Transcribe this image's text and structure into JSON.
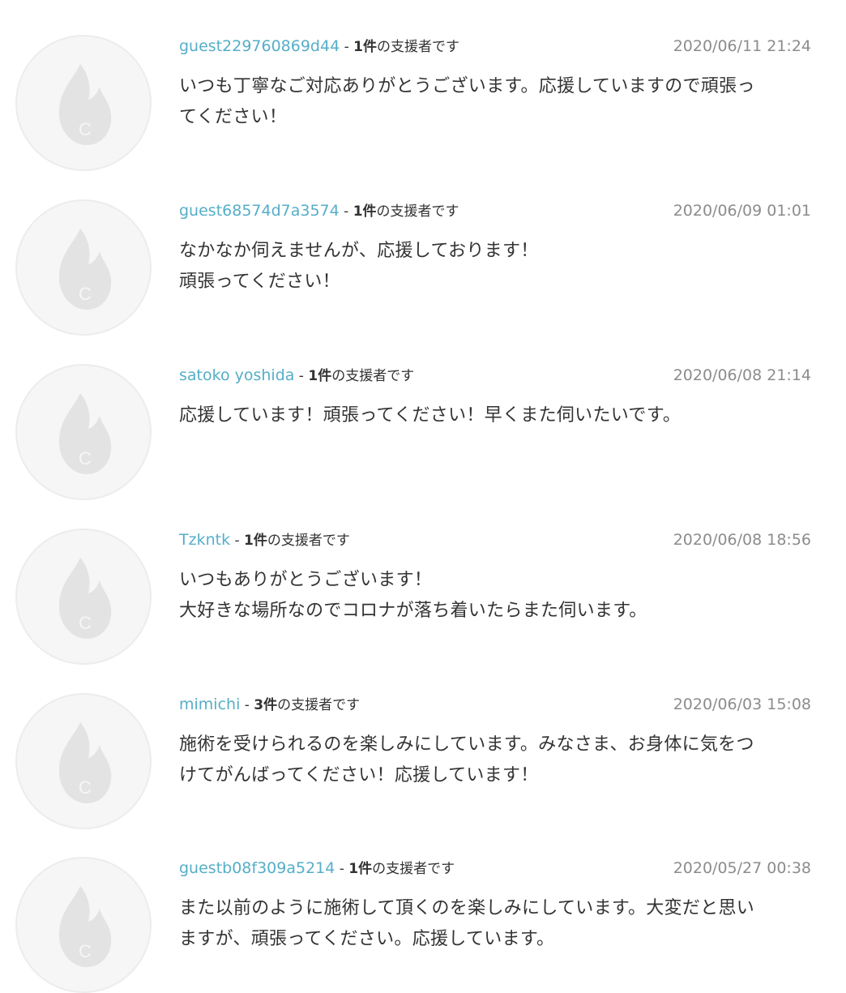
{
  "comments": [
    {
      "username": "guest229760869d44",
      "separator": " - ",
      "support_count": "1件",
      "support_suffix": "の支援者です",
      "timestamp": "2020/06/11 21:24",
      "body": "いつも丁寧なご対応ありがとうございます。応援していますので頑張っ\nてください！",
      "avatar_icon": "flame-c-icon"
    },
    {
      "username": "guest68574d7a3574",
      "separator": " - ",
      "support_count": "1件",
      "support_suffix": "の支援者です",
      "timestamp": "2020/06/09 01:01",
      "body": "なかなか伺えませんが、応援しております！\n頑張ってください！",
      "avatar_icon": "flame-c-icon"
    },
    {
      "username": "satoko yoshida",
      "separator": " - ",
      "support_count": "1件",
      "support_suffix": "の支援者です",
      "timestamp": "2020/06/08 21:14",
      "body": "応援しています！頑張ってください！早くまた伺いたいです。",
      "avatar_icon": "flame-c-icon"
    },
    {
      "username": "Tzkntk",
      "separator": " - ",
      "support_count": "1件",
      "support_suffix": "の支援者です",
      "timestamp": "2020/06/08 18:56",
      "body": "いつもありがとうございます！\n大好きな場所なのでコロナが落ち着いたらまた伺います。",
      "avatar_icon": "flame-c-icon"
    },
    {
      "username": "mimichi",
      "separator": " - ",
      "support_count": "3件",
      "support_suffix": "の支援者です",
      "timestamp": "2020/06/03 15:08",
      "body": "施術を受けられるのを楽しみにしています。みなさま、お身体に気をつ\nけてがんばってください！応援しています！",
      "avatar_icon": "flame-c-icon"
    },
    {
      "username": "guestb08f309a5214",
      "separator": " - ",
      "support_count": "1件",
      "support_suffix": "の支援者です",
      "timestamp": "2020/05/27 00:38",
      "body": "また以前のように施術して頂くのを楽しみにしています。大変だと思い\nますが、頑張ってください。応援しています。",
      "avatar_icon": "flame-c-icon"
    }
  ],
  "colors": {
    "username": "#55aec8",
    "timestamp": "#8c8c8c",
    "text": "#333333",
    "avatar_bg": "#f6f6f6",
    "avatar_icon": "#e3e3e3"
  }
}
